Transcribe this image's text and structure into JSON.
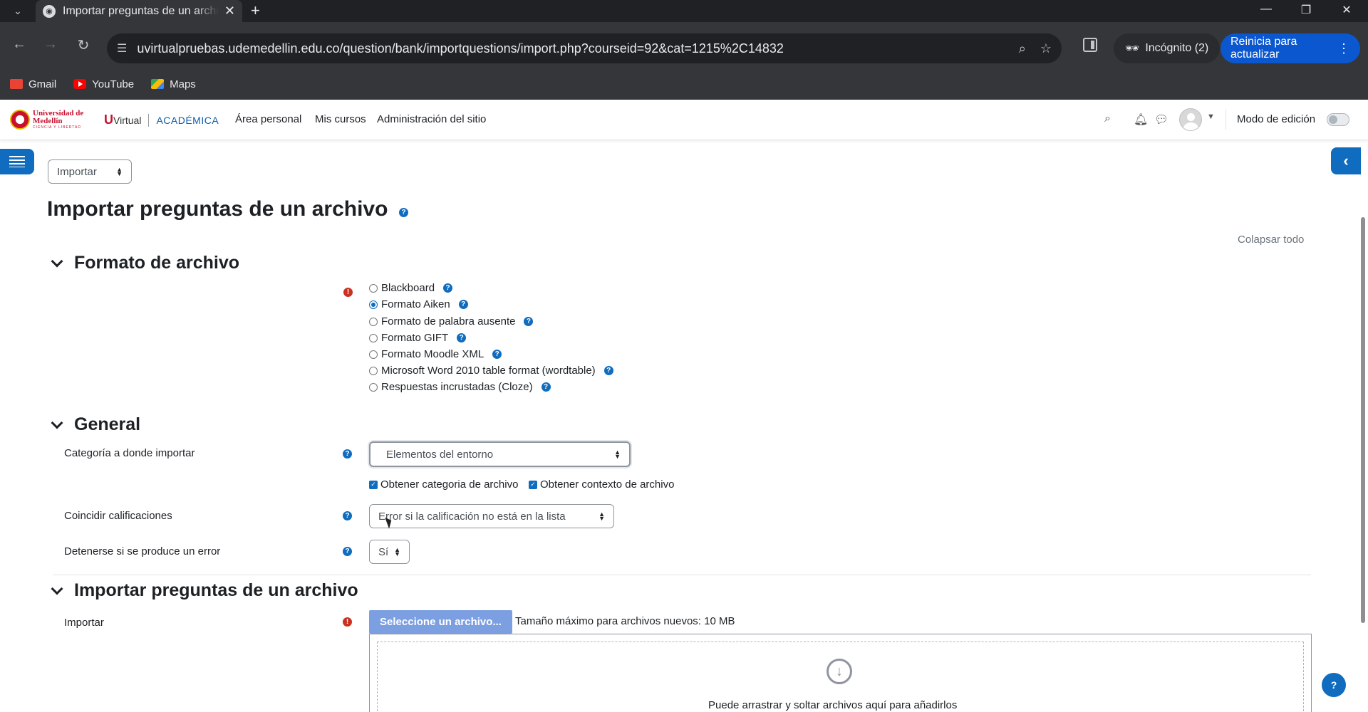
{
  "browser": {
    "tab_title": "Importar preguntas de un archivo",
    "url": "uvirtualpruebas.udemedellin.edu.co/question/bank/importquestions/import.php?courseid=92&cat=1215%2C14832",
    "incognito_label": "Incógnito (2)",
    "update_label": "Reinicia para actualizar",
    "bookmarks": [
      "Gmail",
      "YouTube",
      "Maps"
    ]
  },
  "moodle_nav": {
    "udem_logo_text": "Universidad de Medellín",
    "udem_logo_sub": "CIENCIA Y LIBERTAD",
    "uv_u": "U",
    "uv_virtual": "Virtual",
    "uv_academica": "ACADÉMICA",
    "menu": [
      "Área personal",
      "Mis cursos",
      "Administración del sitio"
    ],
    "edit_mode_label": "Modo de edición"
  },
  "page": {
    "action_select": "Importar",
    "title": "Importar preguntas de un archivo",
    "collapse_all": "Colapsar todo"
  },
  "formato": {
    "title": "Formato de archivo",
    "options": [
      {
        "label": "Blackboard",
        "checked": false
      },
      {
        "label": "Formato Aiken",
        "checked": true
      },
      {
        "label": "Formato de palabra ausente",
        "checked": false
      },
      {
        "label": "Formato GIFT",
        "checked": false
      },
      {
        "label": "Formato Moodle XML",
        "checked": false
      },
      {
        "label": "Microsoft Word 2010 table format (wordtable)",
        "checked": false
      },
      {
        "label": "Respuestas incrustadas (Cloze)",
        "checked": false
      }
    ]
  },
  "general": {
    "title": "General",
    "categoria_label": "Categoría a donde importar",
    "categoria_value": "Elementos del entorno",
    "check_categoria": "Obtener categoria de archivo",
    "check_contexto": "Obtener contexto de archivo",
    "coincidir_label": "Coincidir calificaciones",
    "coincidir_value": "Error si la calificación no está en la lista",
    "detenerse_label": "Detenerse si se produce un error",
    "detenerse_value": "Sí"
  },
  "importar": {
    "title": "Importar preguntas de un archivo",
    "field_label": "Importar",
    "choose_button": "Seleccione un archivo...",
    "max_size": "Tamaño máximo para archivos nuevos: 10 MB",
    "drop_text": "Puede arrastrar y soltar archivos aquí para añadirlos"
  },
  "colors": {
    "primary": "#0f6cbf",
    "required": "#ca3120",
    "chrome_dark": "#202124",
    "chrome_toolbar": "#35363a"
  }
}
